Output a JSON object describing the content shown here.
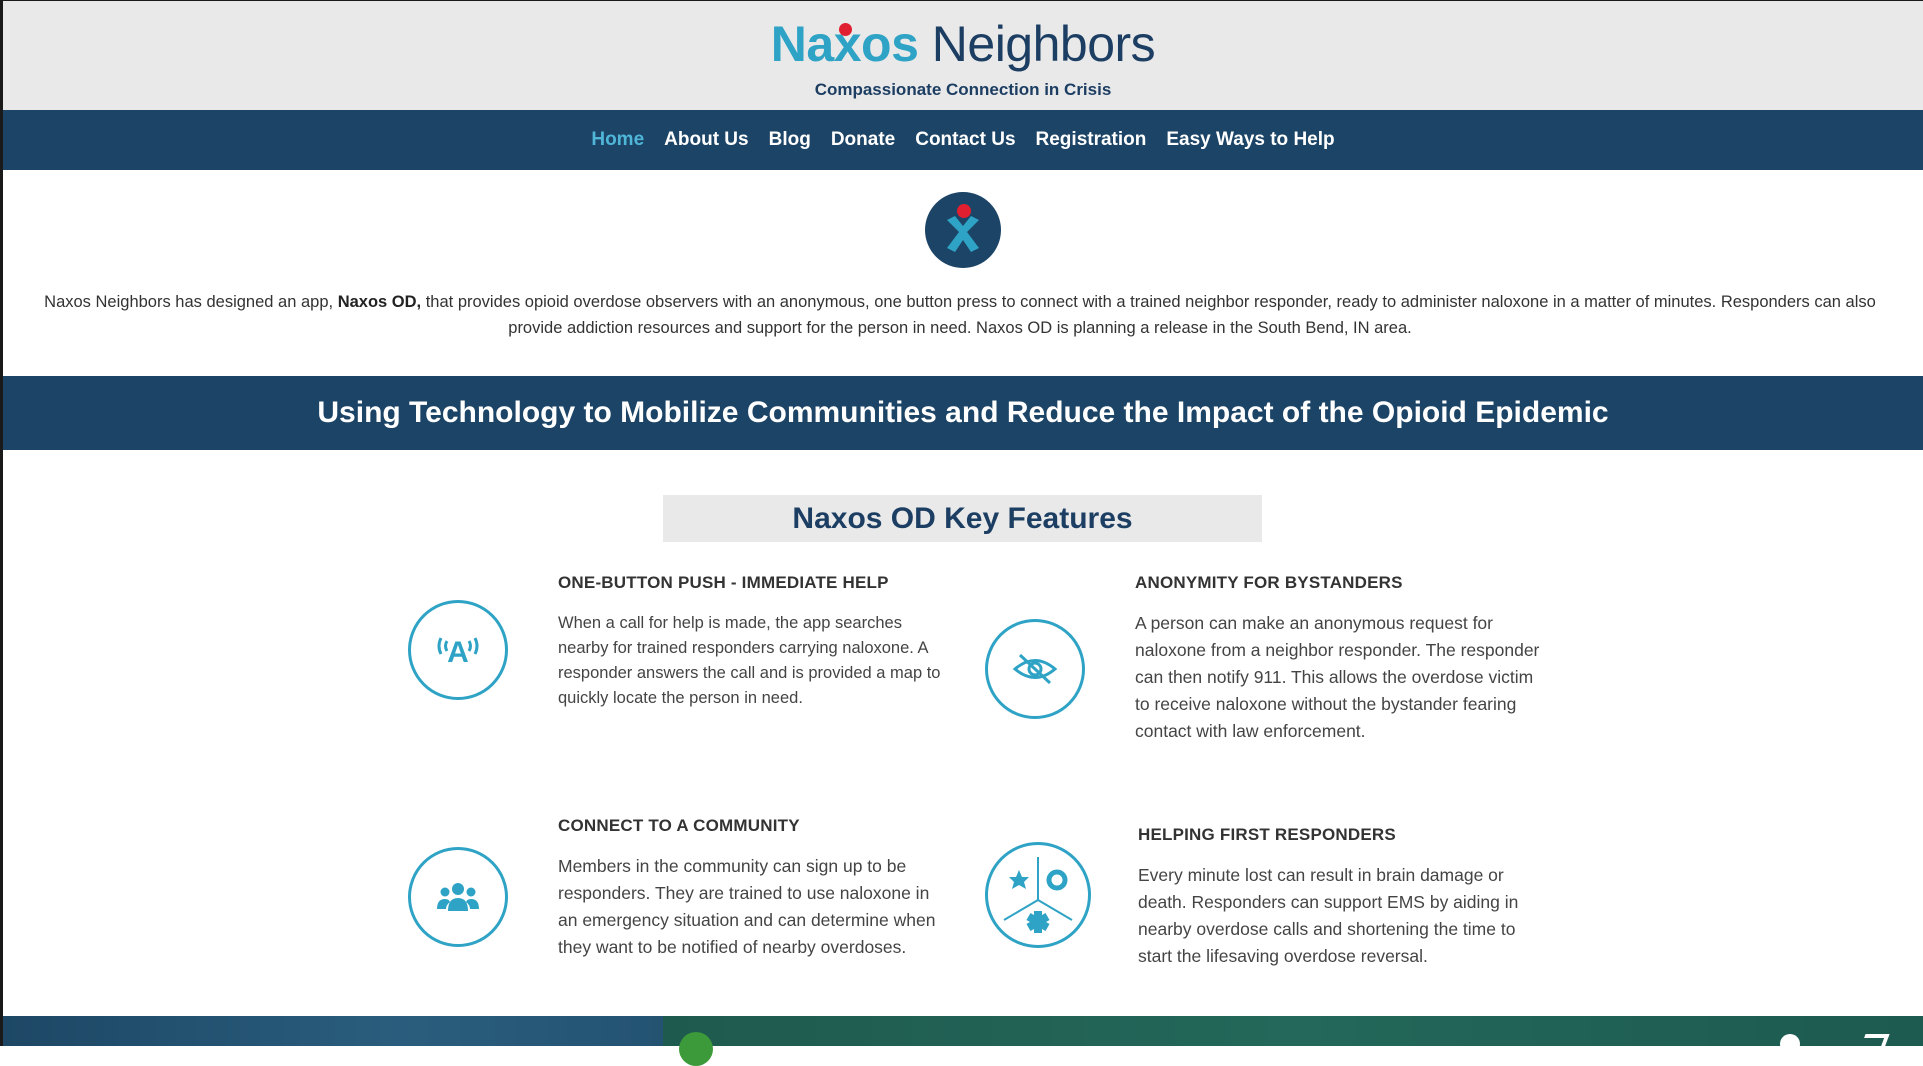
{
  "header": {
    "logo_part1": "Naxos",
    "logo_part2": "Neighbors",
    "tagline": "Compassionate Connection in Crisis"
  },
  "nav": {
    "items": [
      "Home",
      "About Us",
      "Blog",
      "Donate",
      "Contact Us",
      "Registration",
      "Easy Ways to Help"
    ],
    "active": "Home"
  },
  "intro": {
    "prefix": "Naxos Neighbors has designed an app, ",
    "app_name": "Naxos OD,",
    "suffix": " that provides opioid overdose observers with an anonymous, one button press to connect with a trained neighbor responder, ready to administer naloxone in a matter of minutes. Responders can also provide addiction resources and support for the person in need.  Naxos OD is planning a release in the South Bend, IN area."
  },
  "banner": {
    "text": "Using Technology to Mobilize Communities and Reduce the Impact of the Opioid Epidemic"
  },
  "features": {
    "title": "Naxos OD Key Features",
    "items": [
      {
        "heading": "ONE-BUTTON PUSH - IMMEDIATE HELP",
        "body": "When a call for help is made, the app searches nearby for trained responders carrying naloxone. A responder answers the call and is provided a map to quickly locate the person in need.",
        "icon": "broadcast-icon"
      },
      {
        "heading": "ANONYMITY FOR BYSTANDERS",
        "body": "A person can make an anonymous request for naloxone from a neighbor responder. The responder can then notify 911. This allows the overdose victim to receive naloxone without the bystander fearing contact with law enforcement.",
        "icon": "eye-slash-icon"
      },
      {
        "heading": "CONNECT TO A COMMUNITY",
        "body": "Members in the community can sign up to be responders. They are trained to use naloxone in an emergency situation and can determine when they want to be notified of nearby overdoses.",
        "icon": "users-icon"
      },
      {
        "heading": "HELPING FIRST RESPONDERS",
        "body": "Every minute lost can result in brain damage or death. Responders can support EMS by aiding in nearby overdose calls and shortening the time to start the lifesaving overdose reversal.",
        "icon": "first-responders-icon"
      }
    ]
  },
  "colors": {
    "brand_teal": "#2ea3c5",
    "brand_navy": "#1c4466",
    "accent_red": "#e02030",
    "header_bg": "#e9e9e9"
  }
}
